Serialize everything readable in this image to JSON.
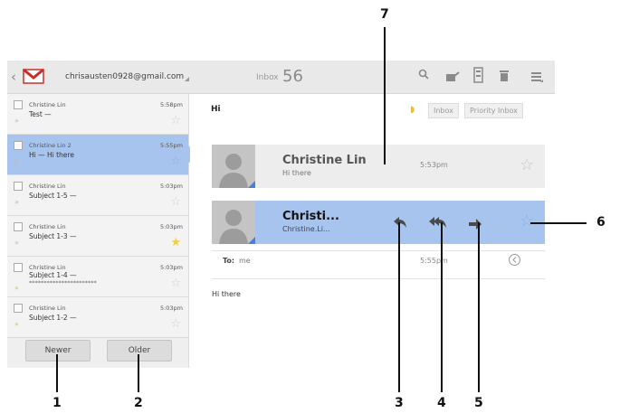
{
  "header": {
    "account": "chrisausten0928@gmail.com",
    "inbox_label": "Inbox",
    "inbox_count": "56"
  },
  "conversation_list": {
    "items": [
      {
        "from": "Christine Lin",
        "subject": "Test —",
        "time": "5:58pm",
        "selected": false
      },
      {
        "from": "Christine Lin 2",
        "subject": "Hi — Hi there",
        "time": "5:55pm",
        "selected": true
      },
      {
        "from": "Christine Lin",
        "subject": "Subject 1-5 —",
        "time": "5:03pm",
        "selected": false
      },
      {
        "from": "Christine Lin",
        "subject": "Subject 1-3 —",
        "time": "5:03pm",
        "selected": false
      },
      {
        "from": "Christine Lin",
        "subject": "Subject 1-4 —",
        "subject_line2": "***********************",
        "time": "5:03pm",
        "selected": false
      },
      {
        "from": "Christine Lin",
        "subject": "Subject 1-2 —",
        "time": "5:03pm",
        "selected": false
      }
    ],
    "newer_label": "Newer",
    "older_label": "Older"
  },
  "message_view": {
    "subject": "Hi",
    "labels": [
      "Inbox",
      "Priority Inbox"
    ],
    "messages": [
      {
        "sender": "Christine Lin",
        "snippet": "Hi there",
        "time": "5:53pm"
      },
      {
        "sender": "Christi...",
        "snippet": "Christine.Li...",
        "time": "5:55pm"
      }
    ],
    "to_label": "To:",
    "to_value": "me",
    "body": "Hi there"
  },
  "callouts": [
    "1",
    "2",
    "3",
    "4",
    "5",
    "6",
    "7"
  ],
  "colors": {
    "accent": "#a6c4ee",
    "gmail_red": "#c8302a"
  }
}
